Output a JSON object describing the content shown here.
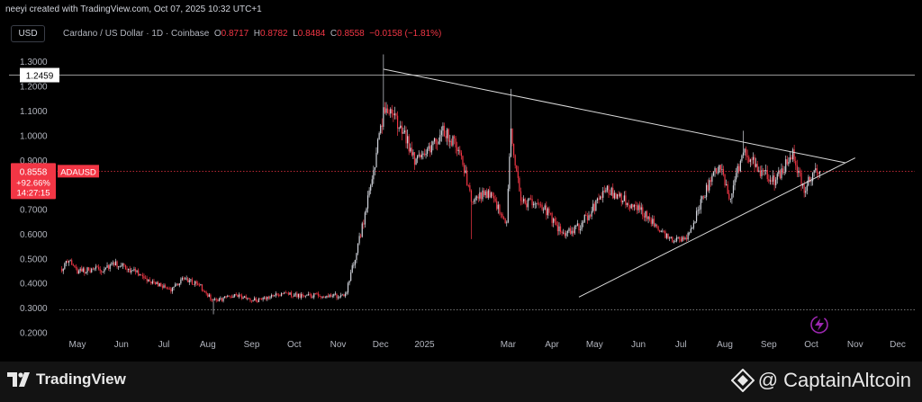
{
  "header": {
    "credit": "neeyi created with TradingView.com, Oct 07, 2025 10:32 UTC+1",
    "currency": "USD",
    "symbol_desc": "Cardano / US Dollar · 1D · Coinbase",
    "open_label": "O",
    "open": "0.8717",
    "high_label": "H",
    "high": "0.8782",
    "low_label": "L",
    "low": "0.8484",
    "close_label": "C",
    "close": "0.8558",
    "change": "−0.0158 (−1.81%)"
  },
  "footer": {
    "brand": "TradingView",
    "watermark": "@ CaptainAltcoin"
  },
  "colors": {
    "background": "#000000",
    "up": "#d1d4dc",
    "down": "#f23645",
    "price_label": "#f23645",
    "grid": "#1a1a1a"
  },
  "chart_data": {
    "type": "candlestick",
    "symbol": "ADAUSD",
    "y_range": [
      0.2,
      1.35
    ],
    "y_ticks": [
      "1.3000",
      "1.2000",
      "1.1000",
      "1.0000",
      "0.9000",
      "0.8000",
      "0.7000",
      "0.6000",
      "0.5000",
      "0.4000",
      "0.3000",
      "0.2000"
    ],
    "x_ticks": [
      {
        "date": "2024-05-01",
        "label": "May"
      },
      {
        "date": "2024-06-01",
        "label": "Jun"
      },
      {
        "date": "2024-07-01",
        "label": "Jul"
      },
      {
        "date": "2024-08-01",
        "label": "Aug"
      },
      {
        "date": "2024-09-01",
        "label": "Sep"
      },
      {
        "date": "2024-10-01",
        "label": "Oct"
      },
      {
        "date": "2024-11-01",
        "label": "Nov"
      },
      {
        "date": "2024-12-01",
        "label": "Dec"
      },
      {
        "date": "2025-01-01",
        "label": "2025"
      },
      {
        "date": "2025-03-01",
        "label": "Mar"
      },
      {
        "date": "2025-04-01",
        "label": "Apr"
      },
      {
        "date": "2025-05-01",
        "label": "May"
      },
      {
        "date": "2025-06-01",
        "label": "Jun"
      },
      {
        "date": "2025-07-01",
        "label": "Jul"
      },
      {
        "date": "2025-08-01",
        "label": "Aug"
      },
      {
        "date": "2025-09-01",
        "label": "Sep"
      },
      {
        "date": "2025-10-01",
        "label": "Oct"
      },
      {
        "date": "2025-11-01",
        "label": "Nov"
      },
      {
        "date": "2025-12-01",
        "label": "Dec"
      }
    ],
    "start_date": "2024-04-20",
    "end_date": "2025-10-07",
    "price_path": [
      [
        "2024-04-20",
        0.46
      ],
      [
        "2024-04-25",
        0.5
      ],
      [
        "2024-05-01",
        0.45
      ],
      [
        "2024-05-20",
        0.46
      ],
      [
        "2024-05-28",
        0.48
      ],
      [
        "2024-06-10",
        0.45
      ],
      [
        "2024-06-25",
        0.4
      ],
      [
        "2024-07-05",
        0.37
      ],
      [
        "2024-07-15",
        0.42
      ],
      [
        "2024-07-25",
        0.4
      ],
      [
        "2024-08-05",
        0.33
      ],
      [
        "2024-08-20",
        0.35
      ],
      [
        "2024-09-05",
        0.33
      ],
      [
        "2024-09-25",
        0.36
      ],
      [
        "2024-10-05",
        0.35
      ],
      [
        "2024-10-25",
        0.35
      ],
      [
        "2024-11-06",
        0.35
      ],
      [
        "2024-11-15",
        0.55
      ],
      [
        "2024-11-25",
        0.82
      ],
      [
        "2024-12-03",
        1.1
      ],
      [
        "2024-12-15",
        1.05
      ],
      [
        "2024-12-25",
        0.9
      ],
      [
        "2025-01-05",
        0.95
      ],
      [
        "2025-01-15",
        1.02
      ],
      [
        "2025-01-25",
        0.95
      ],
      [
        "2025-02-03",
        0.75
      ],
      [
        "2025-02-15",
        0.77
      ],
      [
        "2025-02-28",
        0.65
      ],
      [
        "2025-03-03",
        1.02
      ],
      [
        "2025-03-10",
        0.73
      ],
      [
        "2025-03-25",
        0.72
      ],
      [
        "2025-04-08",
        0.6
      ],
      [
        "2025-04-20",
        0.63
      ],
      [
        "2025-05-10",
        0.78
      ],
      [
        "2025-05-25",
        0.73
      ],
      [
        "2025-06-10",
        0.66
      ],
      [
        "2025-06-25",
        0.57
      ],
      [
        "2025-07-05",
        0.58
      ],
      [
        "2025-07-20",
        0.8
      ],
      [
        "2025-07-28",
        0.88
      ],
      [
        "2025-08-05",
        0.74
      ],
      [
        "2025-08-14",
        0.95
      ],
      [
        "2025-08-25",
        0.86
      ],
      [
        "2025-09-05",
        0.82
      ],
      [
        "2025-09-18",
        0.92
      ],
      [
        "2025-09-26",
        0.78
      ],
      [
        "2025-10-03",
        0.86
      ],
      [
        "2025-10-07",
        0.8558
      ]
    ],
    "spikes": [
      {
        "date": "2024-12-03",
        "high": 1.33
      },
      {
        "date": "2025-03-03",
        "high": 1.19
      },
      {
        "date": "2025-08-14",
        "high": 1.02
      },
      {
        "date": "2024-08-05",
        "low": 0.275
      },
      {
        "date": "2025-02-03",
        "low": 0.58
      }
    ],
    "horizontal_levels": [
      1.2459,
      0.8558,
      0.2935
    ],
    "marker_label": "1.2459",
    "trendlines": [
      {
        "from": [
          "2024-12-03",
          1.27
        ],
        "to": [
          "2025-10-25",
          0.89
        ]
      },
      {
        "from": [
          "2025-04-20",
          0.345
        ],
        "to": [
          "2025-11-01",
          0.91
        ]
      }
    ],
    "last_price": {
      "symbol": "ADAUSD",
      "value": "0.8558",
      "change": "+92.66%",
      "countdown": "14:27:15"
    }
  }
}
